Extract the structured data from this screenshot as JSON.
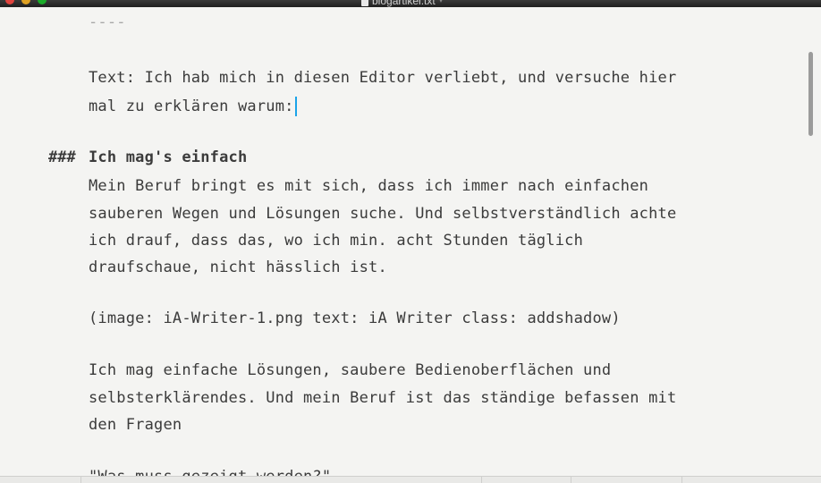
{
  "window": {
    "title": "blogartikel.txt"
  },
  "editor": {
    "lines": {
      "separator": "----",
      "intro_1": "Text: Ich hab mich in diesen Editor verliebt, und versuche hier",
      "intro_2": "mal zu erklären warum:",
      "heading_marker": "###",
      "heading_text": "Ich mag's einfach",
      "p1_1": "Mein Beruf bringt es mit sich, dass ich immer nach einfachen",
      "p1_2": "sauberen Wegen und Lösungen suche. Und selbstverständlich achte",
      "p1_3": "ich drauf, dass das, wo ich min. acht Stunden täglich",
      "p1_4": "draufschaue, nicht hässlich ist.",
      "image_ref": "(image: iA-Writer-1.png text: iA Writer class: addshadow)",
      "p2_1": "Ich mag einfache Lösungen, saubere Bedienoberflächen und",
      "p2_2": "selbsterklärendes. Und mein Beruf ist das ständige befassen mit",
      "p2_3": "den Fragen",
      "quote_partial": "\"Was muss gezeigt werden?\""
    }
  },
  "colors": {
    "background": "#f4f4f2",
    "text": "#3b3b3b",
    "cursor": "#1ba3e8"
  },
  "icons": {
    "close": "close-traffic-light",
    "minimize": "minimize-traffic-light",
    "maximize": "maximize-traffic-light",
    "document": "document-icon",
    "title_menu": "chevron-down-icon"
  }
}
